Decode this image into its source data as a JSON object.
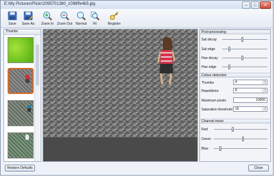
{
  "window": {
    "title": "E:\\My Pictures\\Flickr\\2095701380_1098ffe4b5.jpg"
  },
  "toolbar": {
    "items": [
      {
        "label": "Save",
        "icon": "save-icon"
      },
      {
        "label": "Save As",
        "icon": "save-as-icon"
      },
      {
        "label": "Zoom In",
        "icon": "zoom-in-icon"
      },
      {
        "label": "Zoom Out",
        "icon": "zoom-out-icon"
      },
      {
        "label": "Normal",
        "icon": "zoom-normal-icon"
      },
      {
        "label": "Fit",
        "icon": "fit-icon"
      },
      {
        "label": "Register",
        "icon": "key-icon"
      }
    ]
  },
  "thumbnails": {
    "title": "Thumbs",
    "selected_index": 1
  },
  "post_processing": {
    "title": "Post-processing",
    "sliders": [
      {
        "label": "Sat decay",
        "value": 0.45
      },
      {
        "label": "Sat edge",
        "value": 0.15
      },
      {
        "label": "Hue decay",
        "value": 0.45
      },
      {
        "label": "Hue edge",
        "value": 0.15
      }
    ]
  },
  "colour_detection": {
    "title": "Colour detection",
    "thumbs": {
      "label": "Thumbs",
      "value": "4"
    },
    "repetitions": {
      "label": "Repetitions",
      "value": "8"
    },
    "max_pixels": {
      "label": "Maximum pixels",
      "value": "10000"
    },
    "sat_threshold": {
      "label": "Saturation threshold",
      "value": "16"
    }
  },
  "channel_mixer": {
    "title": "Channel mixer",
    "sliders": [
      {
        "label": "Red",
        "value": 0.35
      },
      {
        "label": "Green",
        "value": 0.55
      },
      {
        "label": "Blue",
        "value": 0.1
      }
    ]
  },
  "buttons": {
    "restore": "Restore Defaults",
    "close": "Close"
  },
  "colors": {
    "accent": "#d56a2c",
    "chrome": "#eef2f8"
  }
}
